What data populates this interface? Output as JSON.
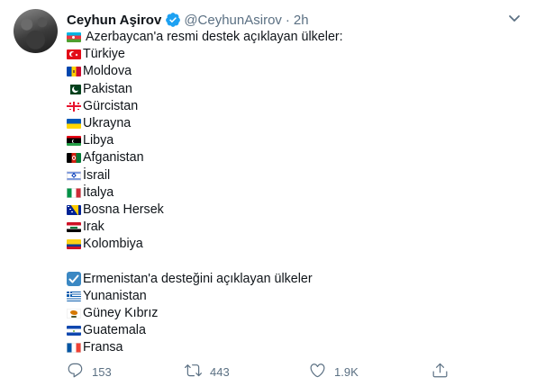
{
  "tweet": {
    "author_name": "Ceyhun Aşirov",
    "handle": "@CeyhunAsirov",
    "separator": "·",
    "time": "2h",
    "intro": "Azerbaycan'a resmi destek açıklayan ülkeler:",
    "support_az": [
      {
        "name": "Türkiye",
        "flag": "turkey-flag"
      },
      {
        "name": "Moldova",
        "flag": "moldova-flag"
      },
      {
        "name": "Pakistan",
        "flag": "pakistan-flag"
      },
      {
        "name": "Gürcistan",
        "flag": "georgia-flag"
      },
      {
        "name": "Ukrayna",
        "flag": "ukraine-flag"
      },
      {
        "name": "Libya",
        "flag": "libya-flag"
      },
      {
        "name": "Afganistan",
        "flag": "afghanistan-flag"
      },
      {
        "name": "İsrail",
        "flag": "israel-flag"
      },
      {
        "name": "İtalya",
        "flag": "italy-flag"
      },
      {
        "name": "Bosna Hersek",
        "flag": "bosnia-flag"
      },
      {
        "name": "Irak",
        "flag": "iraq-flag"
      },
      {
        "name": "Kolombiya",
        "flag": "colombia-flag"
      }
    ],
    "am_intro": "Ermenistan'a desteğini açıklayan ülkeler",
    "support_am": [
      {
        "name": "Yunanistan",
        "flag": "greece-flag"
      },
      {
        "name": "Güney Kıbrız",
        "flag": "cyprus-flag"
      },
      {
        "name": "Guatemala",
        "flag": "guatemala-flag"
      },
      {
        "name": "Fransa",
        "flag": "france-flag"
      }
    ],
    "actions": {
      "replies": "153",
      "retweets": "443",
      "likes": "1.9K"
    }
  },
  "colors": {
    "accent": "#1da1f2",
    "muted": "#5b7083",
    "text": "#0f1419"
  }
}
